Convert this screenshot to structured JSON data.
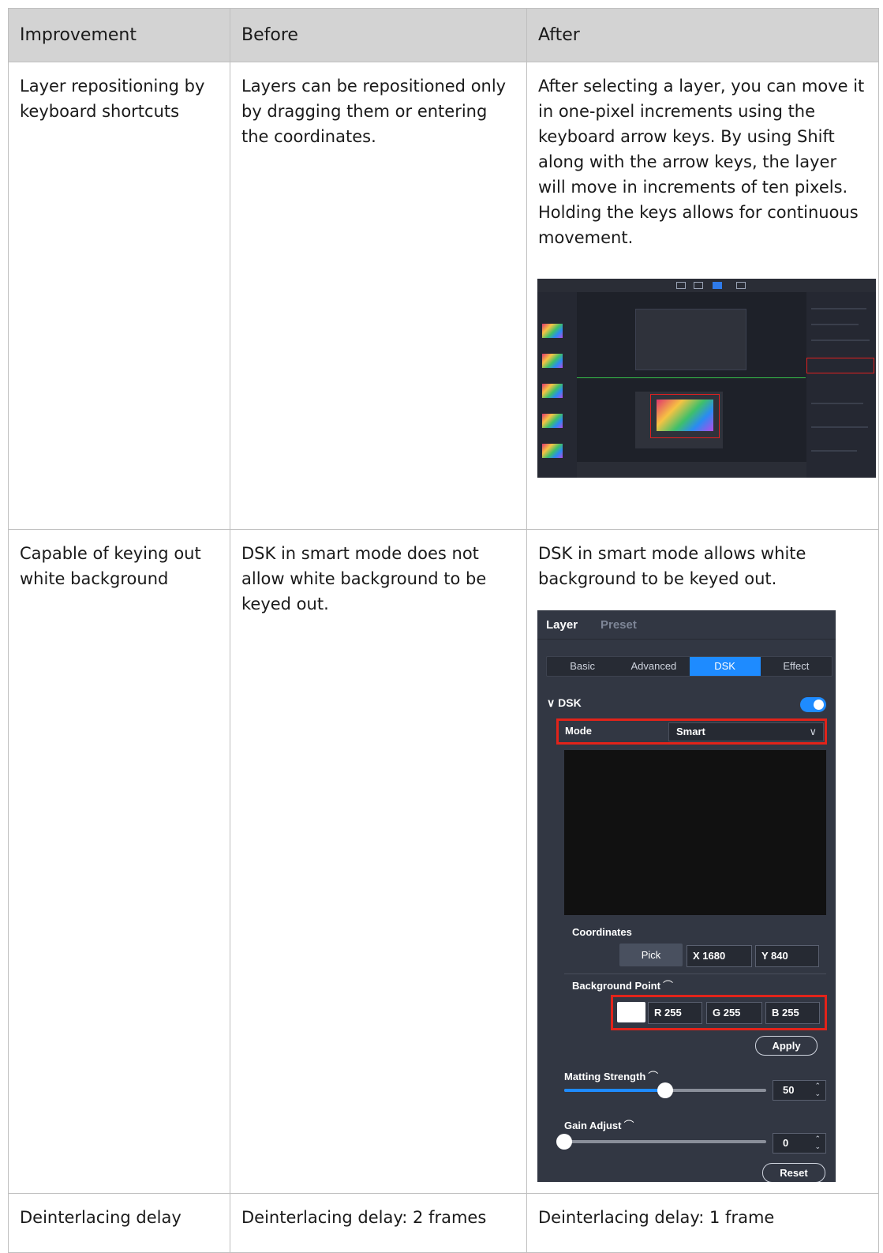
{
  "headers": {
    "improvement": "Improvement",
    "before": "Before",
    "after": "After"
  },
  "rows": [
    {
      "improvement": "Layer repositioning by keyboard shortcuts",
      "before": "Layers can be repositioned only by dragging them or entering the coordinates.",
      "after": "After selecting a layer, you can move it in one-pixel increments using the keyboard arrow keys. By using Shift along with the arrow keys, the layer will move in increments of ten pixels. Holding the keys allows for continuous movement."
    },
    {
      "improvement": "Capable of keying out white background",
      "before": "DSK in smart mode does not allow white background to be keyed out.",
      "after": "DSK in smart mode allows white background to be keyed out."
    },
    {
      "improvement": "Deinterlacing delay",
      "before": "Deinterlacing delay: 2 frames",
      "after": "Deinterlacing delay: 1 frame"
    }
  ],
  "dsk_panel": {
    "header_tabs": [
      "Layer",
      "Preset"
    ],
    "tabs": [
      "Basic",
      "Advanced",
      "DSK",
      "Effect"
    ],
    "active_tab": "DSK",
    "section_title": "DSK",
    "section_chevron": "∨",
    "toggle_on": true,
    "mode_label": "Mode",
    "mode_value": "Smart",
    "mode_chevron": "∨",
    "coordinates_label": "Coordinates",
    "pick_label": "Pick",
    "x_field": "X 1680",
    "y_field": "Y 840",
    "background_point_label": "Background Point",
    "background_color": "#ffffff",
    "r_field": "R 255",
    "g_field": "G 255",
    "b_field": "B 255",
    "apply_label": "Apply",
    "matting_label": "Matting Strength",
    "matting_value": "50",
    "matting_fraction": 0.5,
    "gain_label": "Gain Adjust",
    "gain_value": "0",
    "gain_fraction": 0.0,
    "reset_label": "Reset",
    "undo_icon": "⌒",
    "spin_up": "⌃",
    "spin_down": "⌄"
  },
  "colors": {
    "accent": "#1e8bff",
    "highlight": "#e2231a",
    "panel_bg": "#323743",
    "header_bg": "#d3d3d3"
  }
}
